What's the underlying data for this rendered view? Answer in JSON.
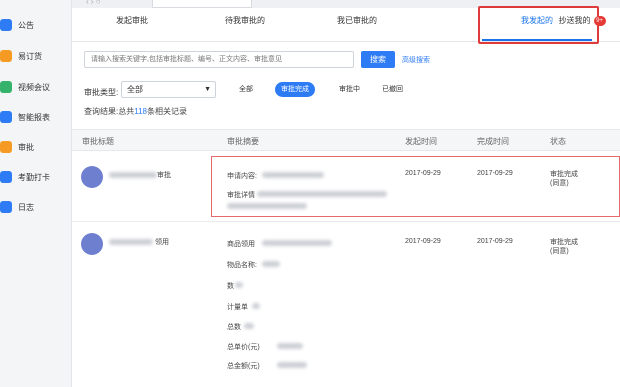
{
  "sidebar": {
    "items": [
      {
        "label": "公告",
        "color": "#2d7cf6"
      },
      {
        "label": "易订货",
        "color": "#f59b23"
      },
      {
        "label": "视频会议",
        "color": "#35b26b"
      },
      {
        "label": "智能报表",
        "color": "#2d7cf6"
      },
      {
        "label": "审批",
        "color": "#f59b23"
      },
      {
        "label": "考勤打卡",
        "color": "#2d7cf6"
      },
      {
        "label": "日志",
        "color": "#2d7cf6"
      }
    ]
  },
  "tabs": [
    {
      "label": "发起审批"
    },
    {
      "label": "待我审批的"
    },
    {
      "label": "我已审批的"
    },
    {
      "label": "我发起的",
      "active": true
    },
    {
      "label": "抄送我的",
      "badge": "9+"
    }
  ],
  "search": {
    "placeholder": "请输入搜索关键字,包括审批标题、编号、正文内容、审批意见",
    "button": "搜索",
    "advanced": "高级搜索"
  },
  "filter": {
    "type_label": "审批类型:",
    "type_value": "全部",
    "status_options": [
      "全部",
      "审批完成",
      "审批中",
      "已撤回"
    ],
    "active_status": "审批完成"
  },
  "result": {
    "prefix": "查询结果:总共",
    "count": "118",
    "suffix": "条相关记录"
  },
  "table": {
    "headers": [
      "审批标题",
      "审批摘要",
      "发起时间",
      "完成时间",
      "状态"
    ],
    "rows": [
      {
        "title_suffix": "审批",
        "summary_lines": [
          "申请内容:",
          "审批详情"
        ],
        "start": "2017-09-29",
        "end": "2017-09-29",
        "status": [
          "审批完成",
          "(同意)"
        ]
      },
      {
        "title_suffix": "领用",
        "summary_lines": [
          "商品领用",
          "物品名称:",
          "数",
          "计量单",
          "总数",
          "总单价(元)",
          "总金额(元)"
        ],
        "start": "2017-09-29",
        "end": "2017-09-29",
        "status": [
          "审批完成",
          "(同意)"
        ]
      }
    ]
  }
}
